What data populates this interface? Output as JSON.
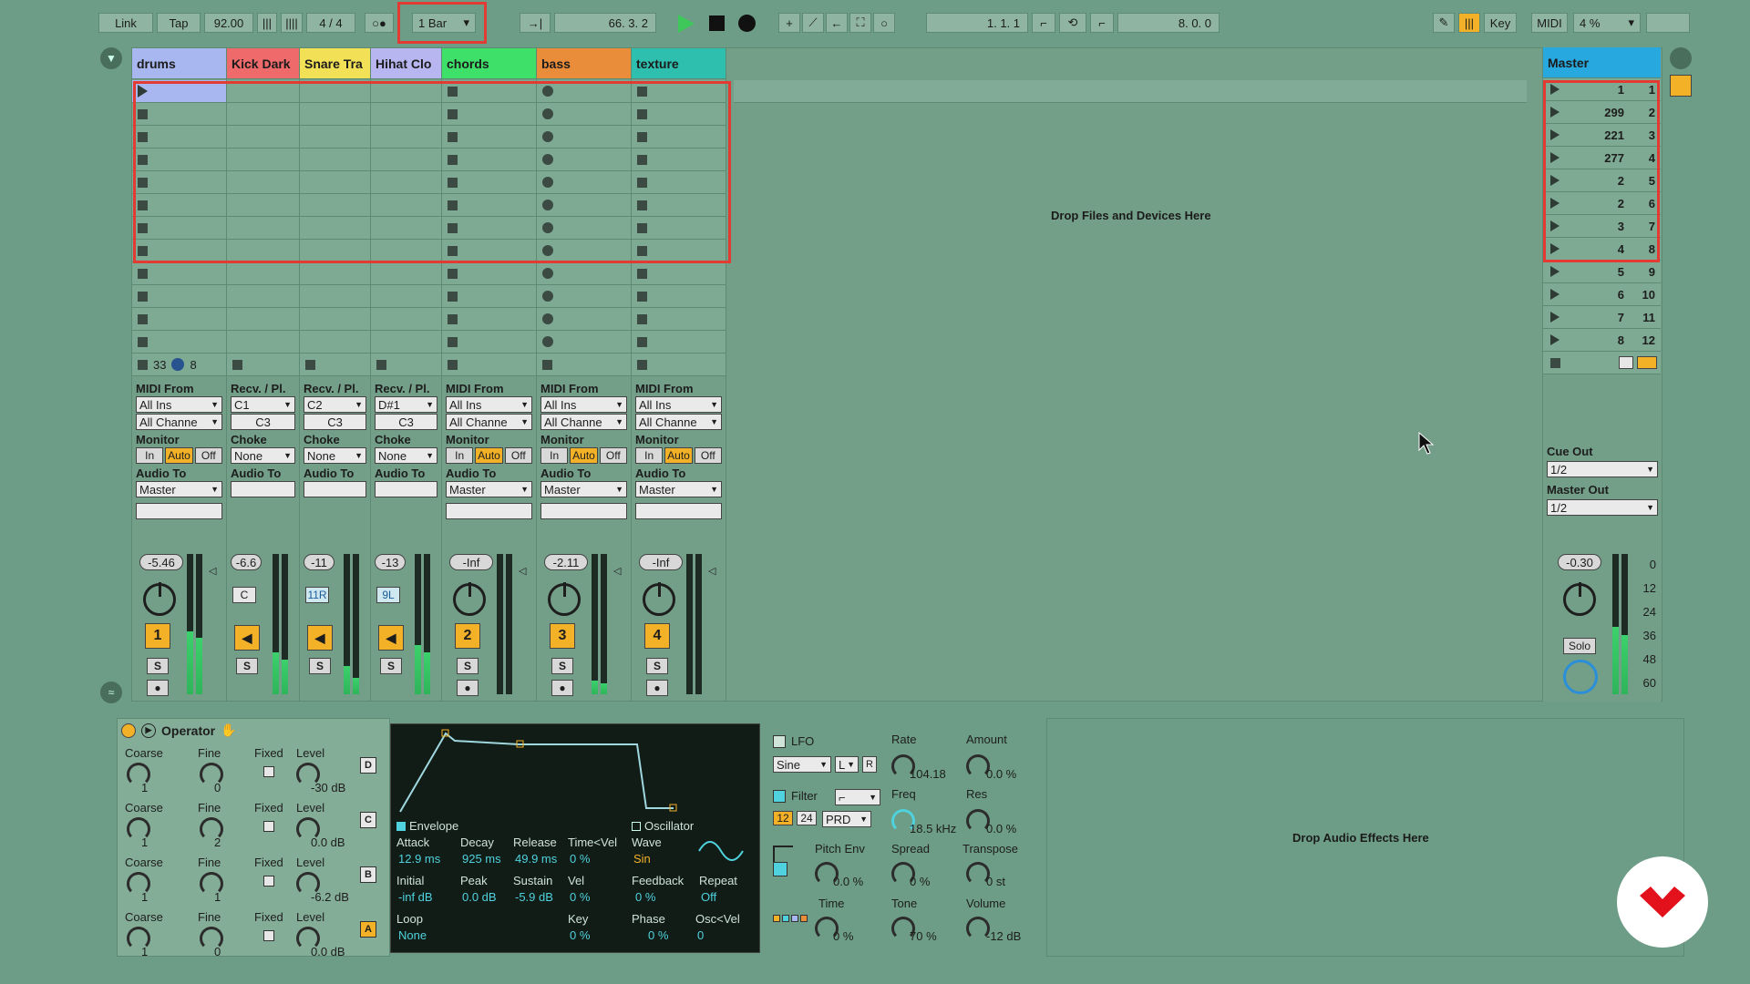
{
  "transport": {
    "link": "Link",
    "tap": "Tap",
    "tempo": "92.00",
    "time_sig": "4 / 4",
    "quantize": "1 Bar",
    "position": "66.  3.  2",
    "loop_start": "1.  1.  1",
    "loop_length": "8.  0.  0",
    "key": "Key",
    "midi": "MIDI",
    "cpu": "4 %"
  },
  "tracks": [
    {
      "name": "drums",
      "color": "#a9b7f0",
      "type": "group"
    },
    {
      "name": "Kick Dark",
      "color": "#ef6a6a",
      "type": "drum"
    },
    {
      "name": "Snare Tra",
      "color": "#f2e056",
      "type": "drum"
    },
    {
      "name": "Hihat Clo",
      "color": "#b8b6f0",
      "type": "drum"
    },
    {
      "name": "chords",
      "color": "#3fe06a",
      "type": "midi"
    },
    {
      "name": "bass",
      "color": "#e98d3a",
      "type": "midi"
    },
    {
      "name": "texture",
      "color": "#2fbfae",
      "type": "midi"
    }
  ],
  "io": {
    "midi_from": "MIDI From",
    "all_ins": "All Ins",
    "all_channels": "All Channe",
    "monitor": "Monitor",
    "in": "In",
    "auto": "Auto",
    "off": "Off",
    "audio_to": "Audio To",
    "master": "Master",
    "recv": "Recv. / Pl.",
    "choke": "Choke",
    "none": "None",
    "kick_in": "C1",
    "snare_in": "C2",
    "hat_in": "D#1",
    "out_note": "C3",
    "group_count_a": "33",
    "group_count_b": "8"
  },
  "mixer": {
    "drums": {
      "vol": "-5.46",
      "num": "1"
    },
    "kick": {
      "vol": "-6.6",
      "pan": "C"
    },
    "snare": {
      "vol": "-11",
      "pan": "11R"
    },
    "hihat": {
      "vol": "-13",
      "pan": "9L"
    },
    "chords": {
      "vol": "-Inf",
      "num": "2"
    },
    "bass": {
      "vol": "-2.11",
      "num": "3"
    },
    "texture": {
      "vol": "-Inf",
      "num": "4"
    },
    "solo": "S"
  },
  "master": {
    "title": "Master",
    "scenes": [
      {
        "name": "1",
        "num": "1"
      },
      {
        "name": "299",
        "num": "2"
      },
      {
        "name": "221",
        "num": "3"
      },
      {
        "name": "277",
        "num": "4"
      },
      {
        "name": "2",
        "num": "5"
      },
      {
        "name": "2",
        "num": "6"
      },
      {
        "name": "3",
        "num": "7"
      },
      {
        "name": "4",
        "num": "8"
      },
      {
        "name": "5",
        "num": "9"
      },
      {
        "name": "6",
        "num": "10"
      },
      {
        "name": "7",
        "num": "11"
      },
      {
        "name": "8",
        "num": "12"
      }
    ],
    "cue_out": "Cue Out",
    "cue_val": "1/2",
    "master_out": "Master Out",
    "master_val": "1/2",
    "vol": "-0.30",
    "solo": "Solo",
    "db_scale": [
      "0",
      "12",
      "24",
      "36",
      "48",
      "60"
    ]
  },
  "drop_files": "Drop Files and Devices Here",
  "drop_effects": "Drop Audio Effects Here",
  "operator": {
    "title": "Operator",
    "rows": [
      {
        "coarse": "1",
        "fine": "0",
        "level": "-30 dB",
        "tag": "D"
      },
      {
        "coarse": "1",
        "fine": "2",
        "level": "0.0 dB",
        "tag": "C"
      },
      {
        "coarse": "1",
        "fine": "1",
        "level": "-6.2 dB",
        "tag": "B"
      },
      {
        "coarse": "1",
        "fine": "0",
        "level": "0.0 dB",
        "tag": "A"
      }
    ],
    "coarse": "Coarse",
    "fine": "Fine",
    "fixed": "Fixed",
    "level": "Level",
    "env": {
      "envelope": "Envelope",
      "oscillator": "Oscillator",
      "attack": "Attack",
      "attack_v": "12.9 ms",
      "decay": "Decay",
      "decay_v": "925 ms",
      "release": "Release",
      "release_v": "49.9 ms",
      "timevel": "Time<Vel",
      "timevel_v": "0 %",
      "wave": "Wave",
      "wave_v": "Sin",
      "initial": "Initial",
      "initial_v": "-inf dB",
      "peak": "Peak",
      "peak_v": "0.0 dB",
      "sustain": "Sustain",
      "sustain_v": "-5.9 dB",
      "vel": "Vel",
      "vel_v": "0 %",
      "feedback": "Feedback",
      "feedback_v": "0 %",
      "repeat": "Repeat",
      "repeat_v": "Off",
      "loop": "Loop",
      "loop_v": "None",
      "key": "Key",
      "key_v": "0 %",
      "phase": "Phase",
      "phase_v": "0 %",
      "oscvel": "Osc<Vel",
      "oscvel_v": "0"
    },
    "lfo": {
      "lfo": "LFO",
      "sine": "Sine",
      "l": "L",
      "r": "R",
      "rate": "Rate",
      "rate_v": "104.18",
      "amount": "Amount",
      "amount_v": "0.0 %",
      "filter": "Filter",
      "f12": "12",
      "f24": "24",
      "prd": "PRD",
      "freq": "Freq",
      "freq_v": "18.5 kHz",
      "res": "Res",
      "res_v": "0.0 %",
      "pitchenv": "Pitch Env",
      "pitchenv_v": "0.0 %",
      "spread": "Spread",
      "spread_v": "0 %",
      "transpose": "Transpose",
      "transpose_v": "0 st",
      "time": "Time",
      "time_v": "0 %",
      "tone": "Tone",
      "tone_v": "70 %",
      "volume": "Volume",
      "volume_v": "-12 dB"
    }
  },
  "colors": {
    "accent": "#f3b128",
    "play": "#3ec85a",
    "highlight": "#e23b33",
    "bg": "#6d9d86"
  }
}
